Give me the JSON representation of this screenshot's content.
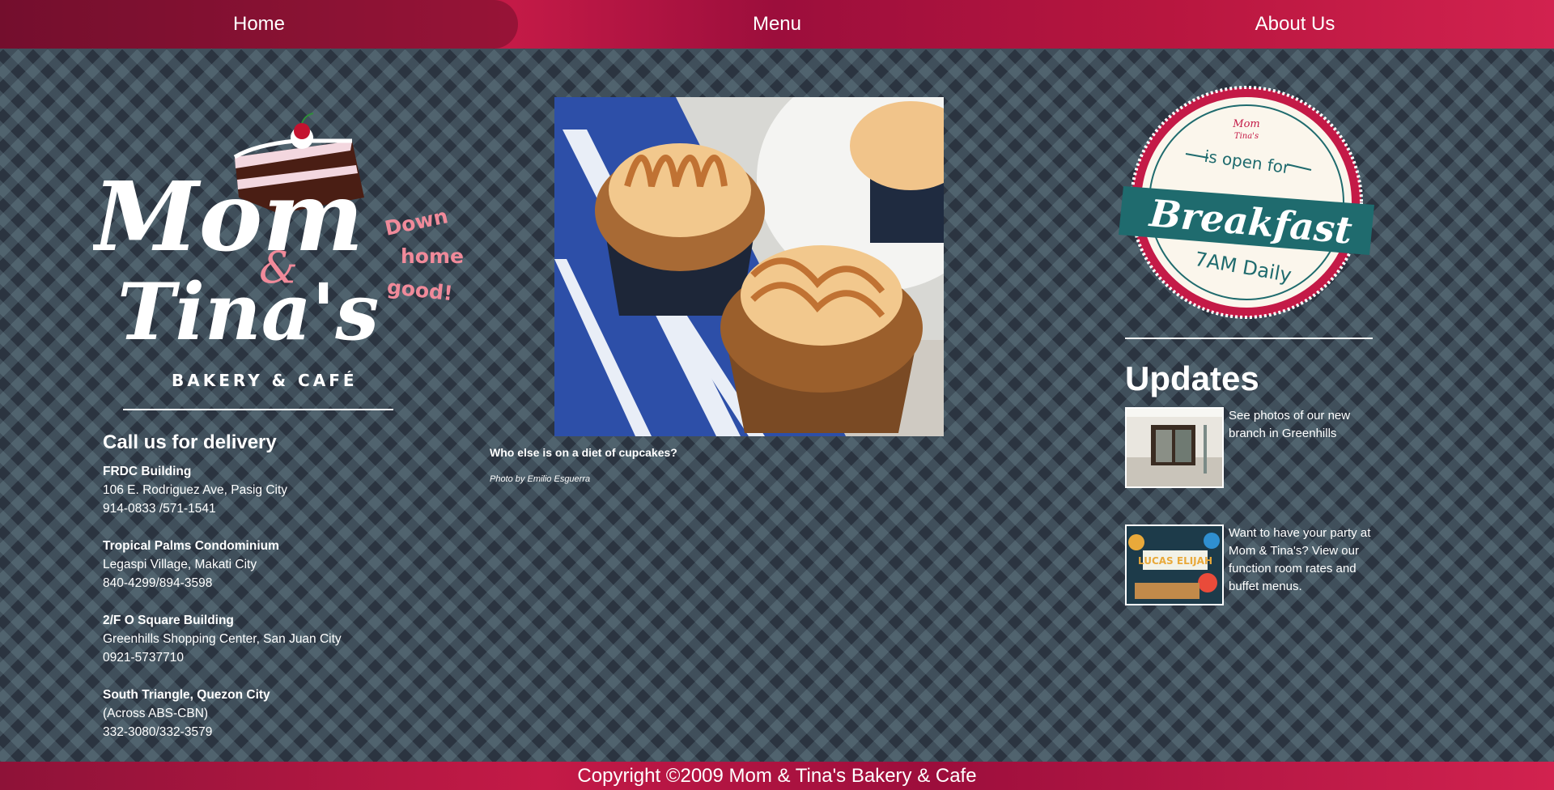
{
  "nav": {
    "items": [
      {
        "label": "Home"
      },
      {
        "label": "Menu"
      },
      {
        "label": "About Us"
      }
    ]
  },
  "brand": {
    "logo_text_line1": "Mom",
    "logo_amp": "&",
    "logo_text_line2": "Tina's",
    "tagline": [
      "Down",
      "home",
      "good!"
    ],
    "subtitle": "BAKERY & CAFÉ"
  },
  "delivery": {
    "heading": "Call us for delivery",
    "branches": [
      {
        "name": "FRDC Building",
        "line1": "106 E. Rodriguez Ave, Pasig City",
        "line2": "914-0833 /571-1541"
      },
      {
        "name": "Tropical Palms Condominium",
        "line1": "Legaspi Village, Makati City",
        "line2": "840-4299/894-3598"
      },
      {
        "name": "2/F O Square Building",
        "line1": "Greenhills Shopping Center, San Juan City",
        "line2": "0921-5737710"
      },
      {
        "name": "South Triangle, Quezon City",
        "line1": "(Across ABS-CBN)",
        "line2": "332-3080/332-3579"
      }
    ]
  },
  "feature": {
    "caption": "Who else is on a diet of cupcakes?",
    "credit": "Photo by Emilio Esguerra"
  },
  "badge": {
    "top": "is open for",
    "main": "Breakfast",
    "bottom": "7AM Daily",
    "mini_logo_line1": "Mom",
    "mini_logo_line2": "Tina's"
  },
  "updates": {
    "heading": "Updates",
    "items": [
      {
        "text": "See photos of our new branch in Greenhills"
      },
      {
        "text": "Want to have your party at Mom & Tina's? View our function room rates and buffet menus."
      }
    ],
    "banner_text": "LUCAS ELIJAH"
  },
  "footer": {
    "copyright": "Copyright ©2009 Mom & Tina's Bakery & Cafe"
  },
  "colors": {
    "brand_crimson": "#c41a47",
    "background": "#2b3440",
    "tagline_pink": "#f08a9a",
    "badge_teal": "#1f6b6e"
  }
}
